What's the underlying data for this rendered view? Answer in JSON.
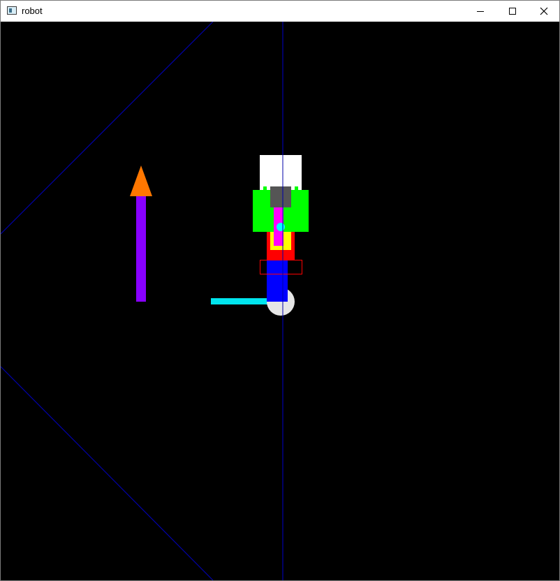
{
  "window": {
    "title": "robot",
    "controls": [
      "minimize",
      "maximize",
      "close"
    ]
  },
  "scene": {
    "background": "#000000",
    "colors": {
      "guide_line": "#0000aa",
      "arrow_shaft": "#8800ff",
      "arrow_head": "#ff7700",
      "head": "#ffffff",
      "neck": "#555555",
      "shoulders": "#00ff00",
      "spine": "#ff00ff",
      "joint": "#00ffff",
      "torso": "#ff0000",
      "torso_inner": "#ffff00",
      "hip_outline": "#ff0000",
      "leg": "#0000ff",
      "wheel": "#e6e6e6",
      "arm": "#00e5ee"
    }
  }
}
